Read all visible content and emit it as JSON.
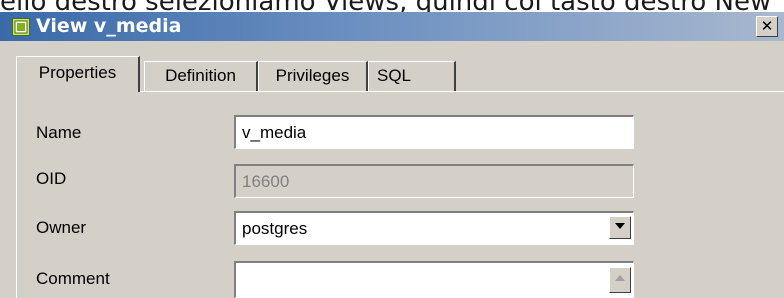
{
  "background_text": "ello destro selezioniamo Views, quindi col tasto destro New",
  "window": {
    "title": "View v_media",
    "icon": "view-icon",
    "close_symbol": "✕",
    "titlebar_color": "#3a6aa9"
  },
  "tabs": [
    {
      "label": "Properties",
      "active": true
    },
    {
      "label": "Definition",
      "active": false
    },
    {
      "label": "Privileges",
      "active": false
    },
    {
      "label": "SQL",
      "active": false
    }
  ],
  "form": {
    "name_label": "Name",
    "name_value": "v_media",
    "oid_label": "OID",
    "oid_value": "16600",
    "owner_label": "Owner",
    "owner_value": "postgres",
    "comment_label": "Comment",
    "comment_value": ""
  },
  "icons": {
    "dropdown": "chevron-down-icon",
    "scroll_up": "scroll-up-icon"
  }
}
